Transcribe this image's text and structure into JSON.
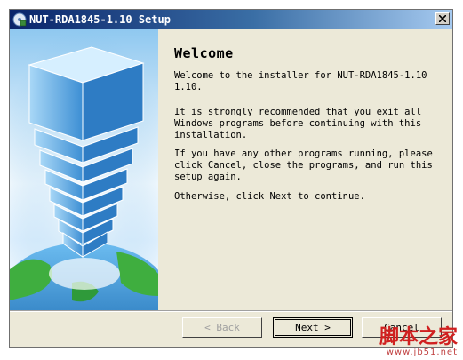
{
  "window": {
    "title": "NUT-RDA1845-1.10 Setup"
  },
  "content": {
    "heading": "Welcome",
    "paragraphs": [
      "Welcome to the installer for NUT-RDA1845-1.10\n1.10.",
      "It is strongly recommended that you exit all\nWindows programs before continuing with this\ninstallation.",
      "If you have any other programs running, please\nclick Cancel, close the programs, and run this\nsetup again.",
      "Otherwise, click Next to continue."
    ]
  },
  "buttons": {
    "back": "< Back",
    "next": "Next >",
    "cancel": "Cancel"
  },
  "watermark": {
    "text": "脚本之家",
    "url": "www.jb51.net"
  },
  "colors": {
    "titlebar_start": "#0a246a",
    "titlebar_end": "#a6caf0",
    "dialog_bg": "#ece9d8"
  },
  "icons": {
    "app": "setup-disc-icon",
    "close": "close-x-icon"
  }
}
